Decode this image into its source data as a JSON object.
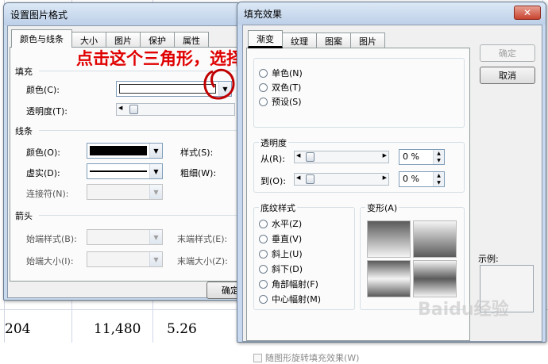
{
  "sheet": {
    "row_values": [
      "204",
      "11,480",
      "5.26"
    ]
  },
  "dialog1": {
    "title": "设置图片格式",
    "tabs": [
      "颜色与线条",
      "大小",
      "图片",
      "保护",
      "属性"
    ],
    "fill_section": "填充",
    "color_label": "颜色(C):",
    "transparency_label": "透明度(T):",
    "line_section": "线条",
    "line_color_label": "颜色(O):",
    "dash_label": "虚实(D):",
    "connector_label": "连接符(N):",
    "style_label": "样式(S):",
    "weight_label": "粗细(W):",
    "arrow_section": "箭头",
    "begin_style_label": "始端样式(B):",
    "end_style_label": "末端样式(E):",
    "begin_size_label": "始端大小(I):",
    "end_size_label": "末端大小(Z):",
    "ok_label": "确定"
  },
  "annotation": "点击这个三角形，选择“填充效果”",
  "dialog2": {
    "title": "填充效果",
    "close": "✕",
    "tabs": [
      "渐变",
      "纹理",
      "图案",
      "图片"
    ],
    "colors_options": [
      "单色(N)",
      "双色(T)",
      "预设(S)"
    ],
    "transparency_group": "透明度",
    "from_label": "从(R):",
    "to_label": "到(O):",
    "from_value": "0 %",
    "to_value": "0 %",
    "shading_group": "底纹样式",
    "shading_options": [
      "水平(Z)",
      "垂直(V)",
      "斜上(U)",
      "斜下(D)",
      "角部幅射(F)",
      "中心幅射(M)"
    ],
    "variants_group": "变形(A)",
    "rotate_checkbox": "随图形旋转填充效果(W)",
    "ok_label": "确定",
    "cancel_label": "取消",
    "sample_label": "示例:"
  },
  "watermark": "Baidu经验"
}
